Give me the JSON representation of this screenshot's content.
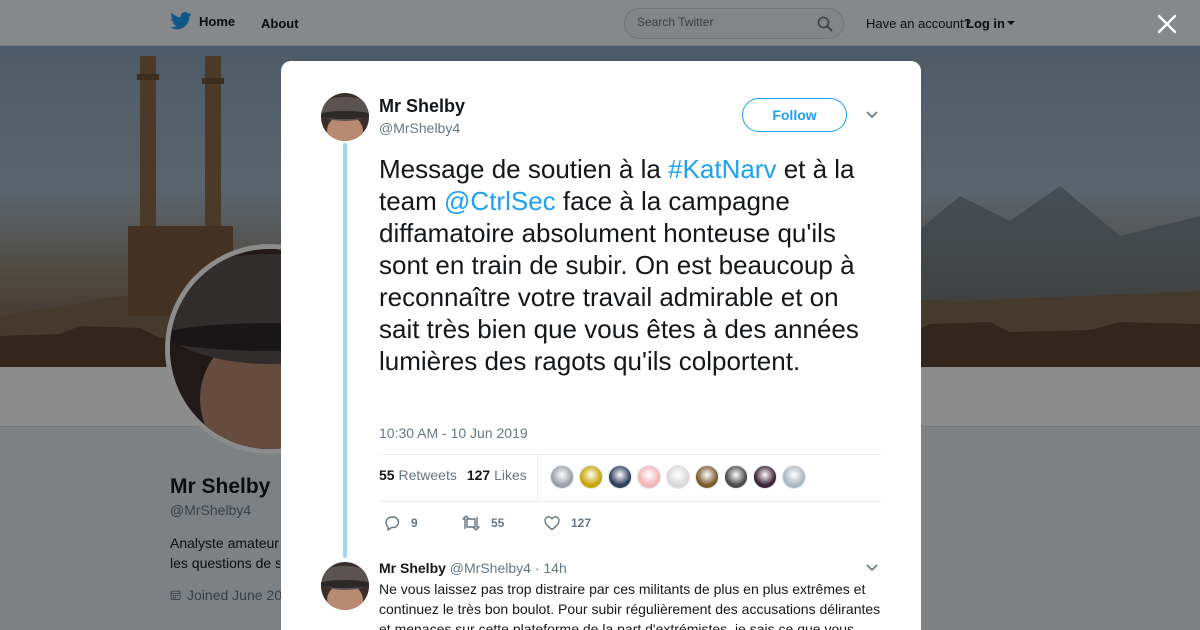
{
  "nav": {
    "home_label": "Home",
    "about_label": "About",
    "search_placeholder": "Search Twitter",
    "account_prompt": "Have an account?",
    "login_label": "Log in"
  },
  "profile": {
    "name": "Mr Shelby",
    "handle": "@MrShelby4",
    "bio_line1": "Analyste amateur",
    "bio_line2": "les questions de s",
    "joined": "Joined June 20"
  },
  "tweet": {
    "author_name": "Mr Shelby",
    "author_handle": "@MrShelby4",
    "follow_label": "Follow",
    "text_1": "Message de soutien à la ",
    "hashtag": "#KatNarv",
    "text_2": " et à la team ",
    "mention": "@CtrlSec",
    "text_3": " face à la campagne diffamatoire absolument honteuse qu'ils sont en train de subir. On est beaucoup à reconnaître votre travail admirable et on sait très bien que vous êtes à des années lumières des ragots qu'ils colportent.",
    "timestamp": "10:30 AM - 10 Jun 2019",
    "retweets_count": "55",
    "retweets_label": "Retweets",
    "likes_count": "127",
    "likes_label": "Likes",
    "reply_count": "9",
    "retweet_count": "55",
    "like_count": "127"
  },
  "likers": [
    {
      "icon": "liker-avatar",
      "color": "#9aa0a6"
    },
    {
      "icon": "liker-avatar",
      "color": "#c8a400"
    },
    {
      "icon": "liker-avatar",
      "color": "#2c3e5a"
    },
    {
      "icon": "liker-avatar",
      "color": "#f2b5b5"
    },
    {
      "icon": "liker-avatar",
      "color": "#d9d9d9"
    },
    {
      "icon": "liker-avatar",
      "color": "#7a5a2a"
    },
    {
      "icon": "liker-avatar",
      "color": "#4a4a4a"
    },
    {
      "icon": "liker-avatar",
      "color": "#3a2233"
    },
    {
      "icon": "liker-avatar",
      "color": "#aab8c2"
    }
  ],
  "reply": {
    "author_name": "Mr Shelby",
    "author_handle": "@MrShelby4",
    "separator": "·",
    "time": "14h",
    "text": "Ne vous laissez pas trop distraire par ces militants de plus en plus extrêmes et continuez le très bon boulot. Pour subir régulièrement des accusations délirantes et menaces sur cette plateforme de la part d'extrémistes, je sais ce que vous"
  },
  "colors": {
    "accent": "#1da1f2",
    "thread_line": "#a5d3f2",
    "text": "#14171a",
    "muted": "#657786"
  }
}
